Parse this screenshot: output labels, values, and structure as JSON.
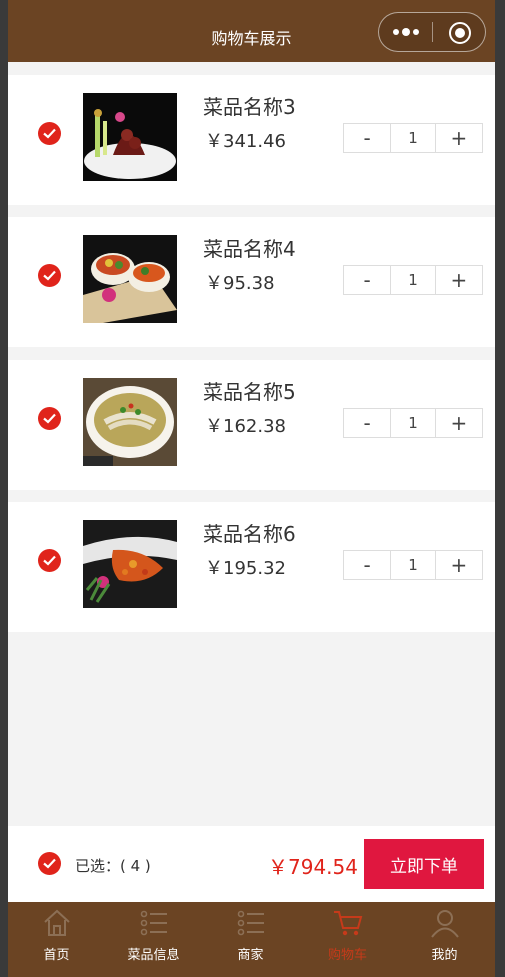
{
  "header": {
    "title": "购物车展示"
  },
  "cart_items": [
    {
      "name": "菜品名称3",
      "price": "￥341.46",
      "qty": "1"
    },
    {
      "name": "菜品名称4",
      "price": "￥95.38",
      "qty": "1"
    },
    {
      "name": "菜品名称5",
      "price": "￥162.38",
      "qty": "1"
    },
    {
      "name": "菜品名称6",
      "price": "￥195.32",
      "qty": "1"
    }
  ],
  "stepper": {
    "minus": "-",
    "plus": "+"
  },
  "summary": {
    "selected": "已选：( 4 )",
    "total": "￥794.54",
    "order_button": "立即下单"
  },
  "tabbar": {
    "tabs": [
      {
        "label": "首页",
        "icon": "home-icon"
      },
      {
        "label": "菜品信息",
        "icon": "list-icon"
      },
      {
        "label": "商家",
        "icon": "list-icon"
      },
      {
        "label": "购物车",
        "icon": "cart-icon",
        "active": true
      },
      {
        "label": "我的",
        "icon": "user-icon"
      }
    ]
  },
  "colors": {
    "header": "#6b4423",
    "accent": "#e0241b",
    "order_button": "#e0173f",
    "active_tab": "#c63a1a"
  }
}
